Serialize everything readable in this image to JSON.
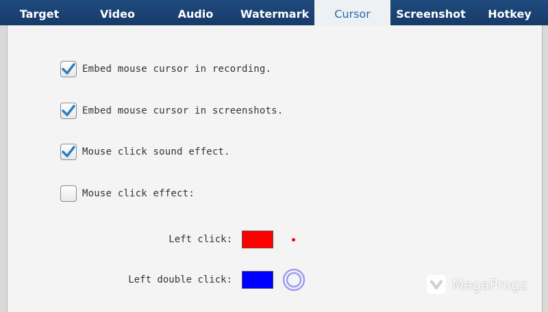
{
  "tabs": [
    {
      "label": "Target",
      "active": false
    },
    {
      "label": "Video",
      "active": false
    },
    {
      "label": "Audio",
      "active": false
    },
    {
      "label": "Watermark",
      "active": false
    },
    {
      "label": "Cursor",
      "active": true
    },
    {
      "label": "Screenshot",
      "active": false
    },
    {
      "label": "Hotkey",
      "active": false
    }
  ],
  "options": [
    {
      "label": "Embed mouse cursor in recording.",
      "checked": true
    },
    {
      "label": "Embed mouse cursor in screenshots.",
      "checked": true
    },
    {
      "label": "Mouse click sound effect.",
      "checked": true
    },
    {
      "label": "Mouse click effect:",
      "checked": false
    }
  ],
  "click_colors": {
    "left_click": {
      "label": "Left click:",
      "color": "#ff0000"
    },
    "left_double_click": {
      "label": "Left double click:",
      "color": "#0000ff"
    }
  },
  "accent": {
    "check": "#2a7fc0",
    "ring": "#9b9bf2"
  },
  "watermark": {
    "text": "MegaProgz",
    "icon": "megaprogz-logo"
  }
}
